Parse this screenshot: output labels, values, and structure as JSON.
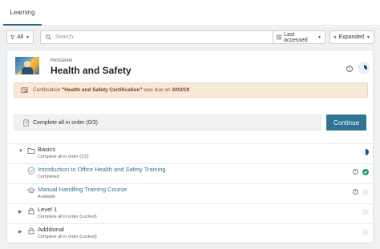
{
  "tabs": [
    {
      "label": "Learning"
    }
  ],
  "toolbar": {
    "filter_label": "All",
    "search_placeholder": "Search",
    "sort_label": "Last accessed",
    "view_label": "Expanded"
  },
  "program": {
    "kind": "PROGRAM",
    "title": "Health and Safety",
    "info_glyph": "i"
  },
  "alert": {
    "prefix": "Certification ",
    "cert_name": "\"Health and Safety Certification\"",
    "middle": " was due on ",
    "due_date": "3/03/19"
  },
  "order": {
    "label": "Complete all in order (0/3)",
    "continue_label": "Continue"
  },
  "items": [
    {
      "name": "Basics",
      "sub": "Complete all in order (1/2)",
      "icon": "folder-icon"
    },
    {
      "name": "Introduction to Office Health and Safety Training",
      "sub": "Completed",
      "icon": "check-circle-icon"
    },
    {
      "name": "Manual Handling Training Course",
      "sub": "Available",
      "icon": "graduation-cap-icon"
    },
    {
      "name": "Level 1",
      "sub": "Complete all in order (Locked)",
      "icon": "lock-icon"
    },
    {
      "name": "Additional",
      "sub": "Complete all in order (Locked)",
      "icon": "lock-icon"
    }
  ],
  "colors": {
    "accent": "#2f7593",
    "progress": "#1f4f8a",
    "complete": "#1a9b5c",
    "alert_bg": "#f7e8d7"
  }
}
